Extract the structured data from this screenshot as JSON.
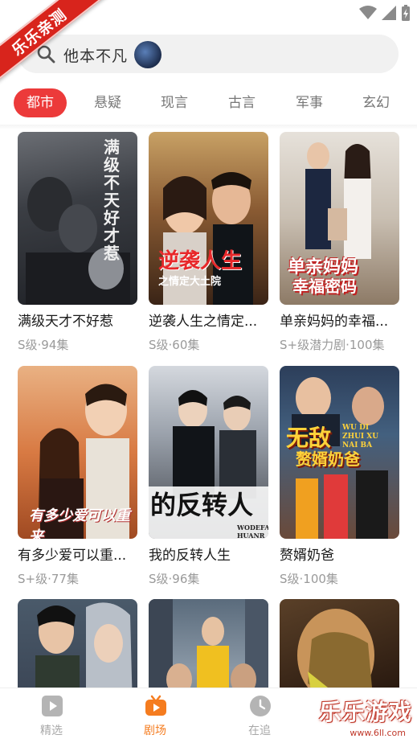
{
  "ribbon": {
    "text": "乐乐亲测"
  },
  "search": {
    "text": "他本不凡"
  },
  "tabs": [
    {
      "label": "都市",
      "active": true
    },
    {
      "label": "悬疑"
    },
    {
      "label": "现言"
    },
    {
      "label": "古言"
    },
    {
      "label": "军事"
    },
    {
      "label": "玄幻"
    }
  ],
  "dramas": [
    {
      "title": "满级天才不好惹",
      "meta": "S级·94集",
      "poster_text": "满级不天好才惹"
    },
    {
      "title": "逆袭人生之情定...",
      "meta": "S级·60集",
      "poster_text": "逆袭人生",
      "poster_sub": "之情定大土院"
    },
    {
      "title": "单亲妈妈的幸福...",
      "meta": "S+级潜力剧·100集",
      "poster_text": "单亲妈妈",
      "poster_sub": "幸福密码"
    },
    {
      "title": "有多少爱可以重...",
      "meta": "S+级·77集",
      "poster_text": "有多少爱可以重来"
    },
    {
      "title": "我的反转人生",
      "meta": "S级·96集",
      "poster_text": "的反转人",
      "poster_sub": "WODEFAN HUANR"
    },
    {
      "title": "赘婿奶爸",
      "meta": "S级·100集",
      "poster_text": "无敌",
      "poster_sub": "赘婿奶爸",
      "poster_en": "WU DI ZHUI XU NAI BA"
    },
    {
      "title": "",
      "meta": ""
    },
    {
      "title": "",
      "meta": ""
    },
    {
      "title": "",
      "meta": ""
    }
  ],
  "bottom_nav": [
    {
      "label": "精选",
      "icon": "play-square-icon"
    },
    {
      "label": "剧场",
      "icon": "tv-icon",
      "active": true
    },
    {
      "label": "在追",
      "icon": "clock-icon"
    }
  ],
  "watermark": {
    "text": "乐乐游戏",
    "url": "www.6ll.com"
  },
  "colors": {
    "accent": "#ec3a3a",
    "nav_active": "#f57c1f",
    "ribbon": "#d8241c"
  }
}
